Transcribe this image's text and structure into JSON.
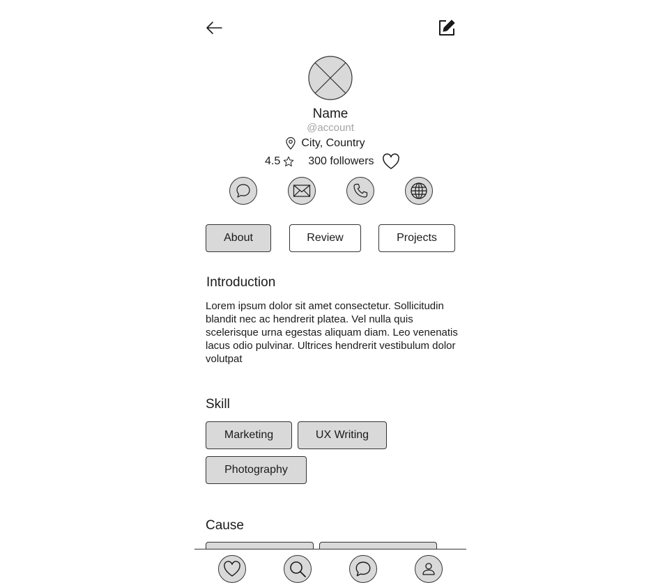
{
  "header": {
    "back_icon": "arrow-left-icon",
    "edit_icon": "edit-square-icon"
  },
  "profile": {
    "name": "Name",
    "account": "@account",
    "location": "City, Country",
    "rating": "4.5",
    "followers": "300 followers"
  },
  "contact_icons": [
    "chat-bubble-icon",
    "mail-icon",
    "phone-icon",
    "globe-icon"
  ],
  "tabs": [
    {
      "label": "About",
      "active": true
    },
    {
      "label": "Review",
      "active": false
    },
    {
      "label": "Projects",
      "active": false
    }
  ],
  "intro": {
    "title": "Introduction",
    "text": "Lorem ipsum dolor sit amet consectetur. Sollicitudin blandit nec ac hendrerit platea. Vel nulla quis scelerisque urna egestas aliquam diam. Leo venenatis lacus odio pulvinar. Ultrices hendrerit vestibulum dolor volutpat"
  },
  "skill": {
    "title": "Skill",
    "chips": [
      "Marketing",
      "UX Writing",
      "Photography"
    ]
  },
  "cause": {
    "title": "Cause"
  },
  "bottom_nav": [
    "heart-icon",
    "search-icon",
    "chat-icon",
    "profile-icon"
  ],
  "colors": {
    "chip_fill": "#d9d9d9",
    "border": "#333333",
    "muted_text": "#a3a3a3"
  }
}
